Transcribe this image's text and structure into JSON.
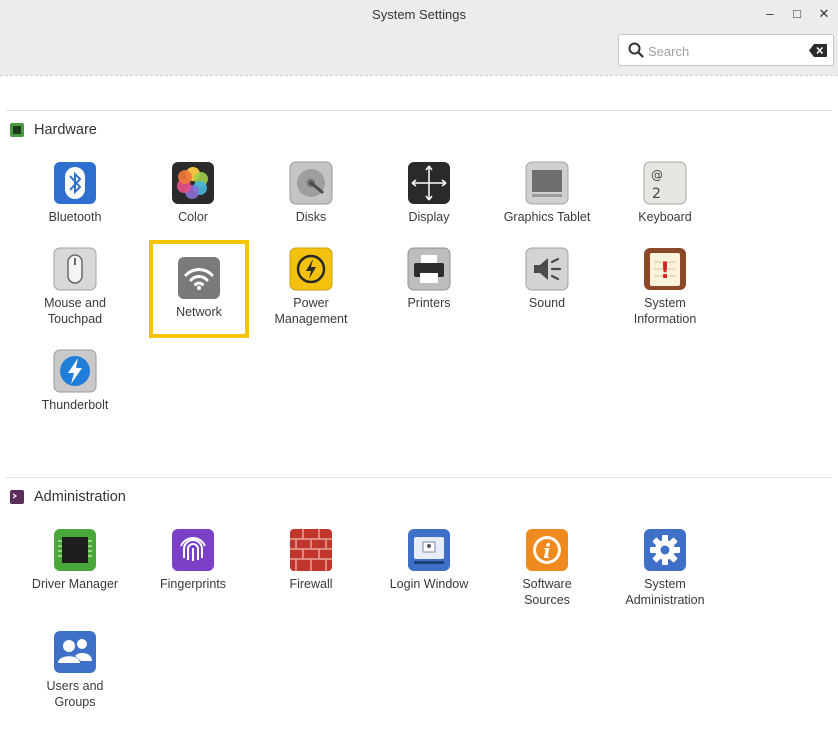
{
  "window": {
    "title": "System Settings",
    "minimize_glyph": "–",
    "maximize_glyph": "□",
    "close_glyph": "✕"
  },
  "search": {
    "placeholder": "Search",
    "value": ""
  },
  "sections": {
    "hardware": {
      "title": "Hardware",
      "items": [
        {
          "label": "Bluetooth",
          "icon": "bluetooth-icon"
        },
        {
          "label": "Color",
          "icon": "color-icon"
        },
        {
          "label": "Disks",
          "icon": "disks-icon"
        },
        {
          "label": "Display",
          "icon": "display-icon"
        },
        {
          "label": "Graphics Tablet",
          "icon": "graphics-tablet-icon"
        },
        {
          "label": "Keyboard",
          "icon": "keyboard-icon"
        },
        {
          "label": "Mouse and\nTouchpad",
          "icon": "mouse-icon"
        },
        {
          "label": "Network",
          "icon": "network-icon"
        },
        {
          "label": "Power\nManagement",
          "icon": "power-icon"
        },
        {
          "label": "Printers",
          "icon": "printer-icon"
        },
        {
          "label": "Sound",
          "icon": "sound-icon"
        },
        {
          "label": "System\nInformation",
          "icon": "system-information-icon"
        },
        {
          "label": "Thunderbolt",
          "icon": "thunderbolt-icon"
        }
      ]
    },
    "administration": {
      "title": "Administration",
      "items": [
        {
          "label": "Driver Manager",
          "icon": "driver-manager-icon"
        },
        {
          "label": "Fingerprints",
          "icon": "fingerprint-icon"
        },
        {
          "label": "Firewall",
          "icon": "firewall-icon"
        },
        {
          "label": "Login Window",
          "icon": "login-window-icon"
        },
        {
          "label": "Software\nSources",
          "icon": "software-sources-icon"
        },
        {
          "label": "System\nAdministration",
          "icon": "gear-icon"
        },
        {
          "label": "Users and\nGroups",
          "icon": "users-icon"
        }
      ]
    }
  },
  "icon_text": {
    "keyboard_at": "@",
    "keyboard_two": "2",
    "sysinfo_bang": "!",
    "software_i": "i"
  },
  "highlighted_item": "Network",
  "colors": {
    "highlight": "#f5c400",
    "bluetooth": "#2f6fcf",
    "power": "#f4c20d",
    "admin_accent": "#3e70c8"
  }
}
